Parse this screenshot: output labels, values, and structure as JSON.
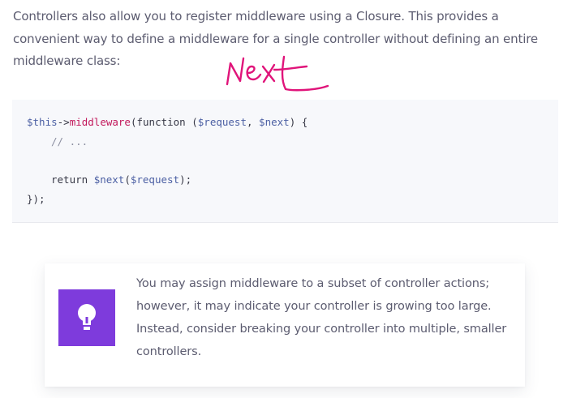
{
  "intro": {
    "text": "Controllers also allow you to register middleware using a Closure. This provides a convenient way to define a middleware for a single controller without defining an entire middleware class:"
  },
  "annotation": {
    "handwritten_text": "next",
    "color": "#e0147a"
  },
  "code": {
    "line1": {
      "this": "$this",
      "arrow": "->",
      "method": "middleware",
      "rest_a": "(function (",
      "param1": "$request",
      "comma": ", ",
      "param2": "$next",
      "rest_b": ") {"
    },
    "line2": {
      "comment": "// ..."
    },
    "line3": {
      "keyword": "return ",
      "var": "$next",
      "open": "(",
      "arg": "$request",
      "close": ");"
    },
    "line4": {
      "text": "});"
    }
  },
  "tip": {
    "icon": "lightbulb-icon",
    "accent_color": "#7e3bdc",
    "text": "You may assign middleware to a subset of controller actions; however, it may indicate your controller is growing too large. Instead, consider breaking your controller into multiple, smaller controllers."
  }
}
